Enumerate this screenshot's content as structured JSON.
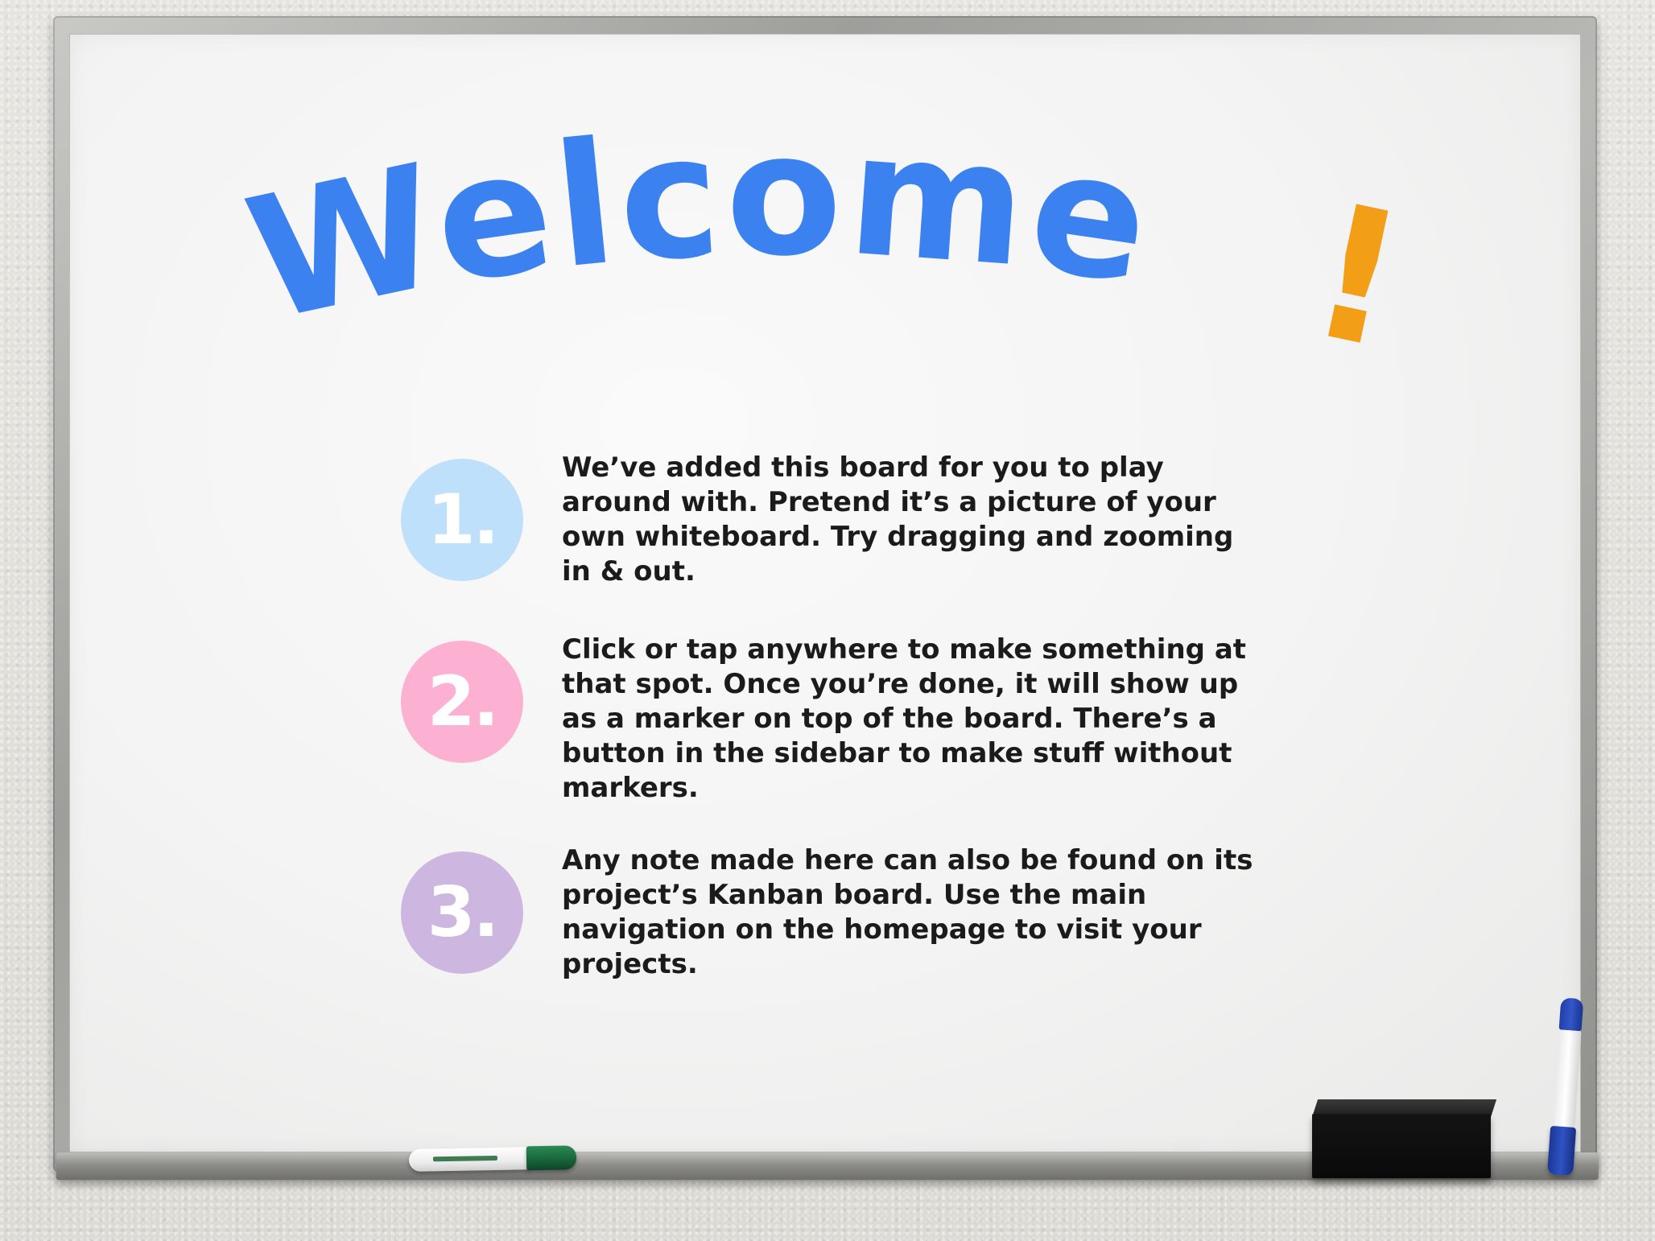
{
  "title": {
    "word": "Welcome",
    "punctuation": "!",
    "word_color": "#3b82f0",
    "punctuation_color": "#f29e17"
  },
  "steps": [
    {
      "number": "1.",
      "color": "#bfe0fb",
      "text": "We’ve added this board for you to play around with. Pretend it’s a picture of your own whiteboard. Try dragging and zooming in & out."
    },
    {
      "number": "2.",
      "color": "#fcb0d2",
      "text": "Click or tap anywhere to make something at that spot. Once you’re done, it will show up as a marker on top of the board. There’s a button in the sidebar to make stuff without markers."
    },
    {
      "number": "3.",
      "color": "#cdb6df",
      "text": "Any note made here can also be found on its project’s Kanban board. Use the main navigation on the homepage to visit your projects."
    }
  ]
}
